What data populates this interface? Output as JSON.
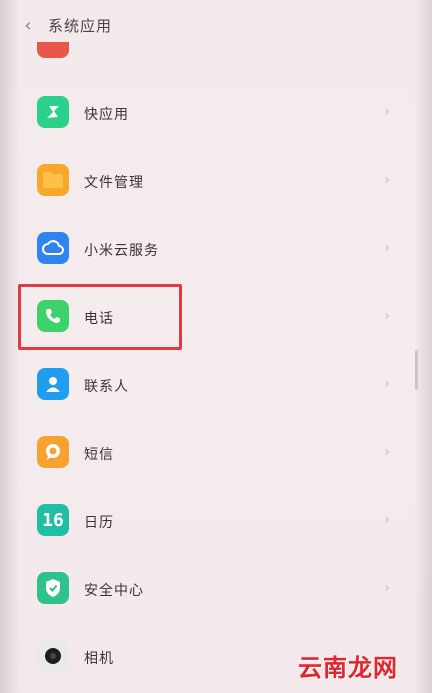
{
  "header": {
    "back_icon": "chevron-left-icon",
    "title": "系统应用"
  },
  "items": [
    {
      "label": "快应用",
      "icon": "quick-app-icon",
      "color": "#2bd08a"
    },
    {
      "label": "文件管理",
      "icon": "folder-icon",
      "color": "#f7a828"
    },
    {
      "label": "小米云服务",
      "icon": "cloud-icon",
      "color": "#2f84f0"
    },
    {
      "label": "电话",
      "icon": "phone-icon",
      "color": "#3ed36a"
    },
    {
      "label": "联系人",
      "icon": "contact-icon",
      "color": "#1f9ef0"
    },
    {
      "label": "短信",
      "icon": "message-icon",
      "color": "#f6a130"
    },
    {
      "label": "日历",
      "icon": "calendar-icon",
      "color": "#1fbfa4",
      "icon_text": "16"
    },
    {
      "label": "安全中心",
      "icon": "shield-icon",
      "color": "#2fc28c"
    },
    {
      "label": "相机",
      "icon": "camera-icon",
      "color": "#eaeaea"
    }
  ],
  "highlight_color": "#e03b44",
  "watermark": "云南龙网"
}
